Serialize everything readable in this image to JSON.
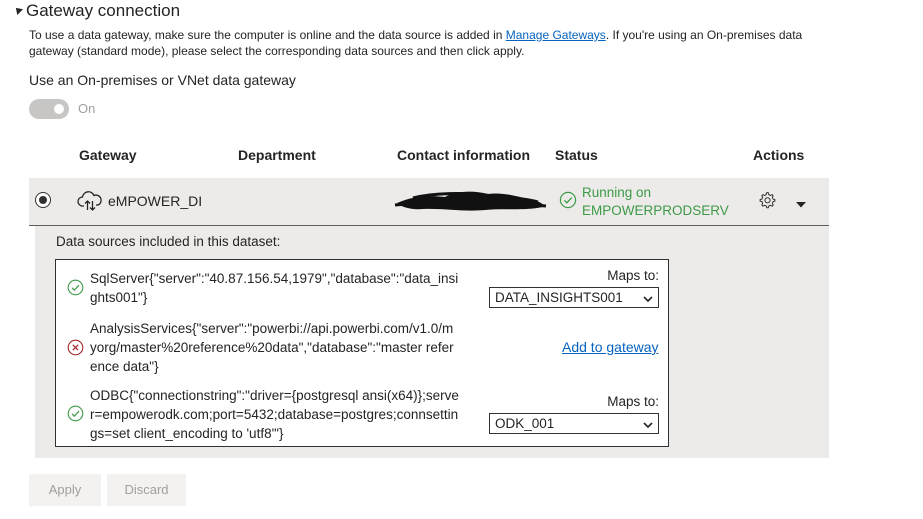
{
  "section": {
    "title": "Gateway connection",
    "description_before": "To use a data gateway, make sure the computer is online and the data source is added in ",
    "description_link": "Manage Gateways",
    "description_after": ". If you're using an On-premises data gateway (standard mode), please select the corresponding data sources and then click apply."
  },
  "gateway_toggle": {
    "label": "Use an On-premises or VNet data gateway",
    "state": "On"
  },
  "table": {
    "headers": [
      "Gateway",
      "Department",
      "Contact information",
      "Status",
      "Actions"
    ],
    "row": {
      "gateway_name": "eMPOWER_DI",
      "status_line1": "Running on",
      "status_line2": "EMPOWERPRODSERV"
    }
  },
  "datasources": {
    "title": "Data sources included in this dataset:",
    "items": [
      {
        "text": "SqlServer{\"server\":\"40.87.156.54,1979\",\"database\":\"data_insights001\"}",
        "status": "ok",
        "maps_label": "Maps to:",
        "selected": "DATA_INSIGHTS001"
      },
      {
        "text": "AnalysisServices{\"server\":\"powerbi://api.powerbi.com/v1.0/myorg/master%20reference%20data\",\"database\":\"master reference data\"}",
        "status": "error",
        "action": "Add to gateway"
      },
      {
        "text": "ODBC{\"connectionstring\":\"driver={postgresql ansi(x64)};server=empowerodk.com;port=5432;database=postgres;connsettings=set client_encoding to 'utf8'\"}",
        "status": "ok",
        "maps_label": "Maps to:",
        "selected": "ODK_001"
      }
    ]
  },
  "buttons": {
    "apply": "Apply",
    "discard": "Discard"
  },
  "colors": {
    "link": "#0563c1",
    "success": "#3c9a46",
    "error": "#a4262c",
    "row_bg": "#edebe9"
  }
}
